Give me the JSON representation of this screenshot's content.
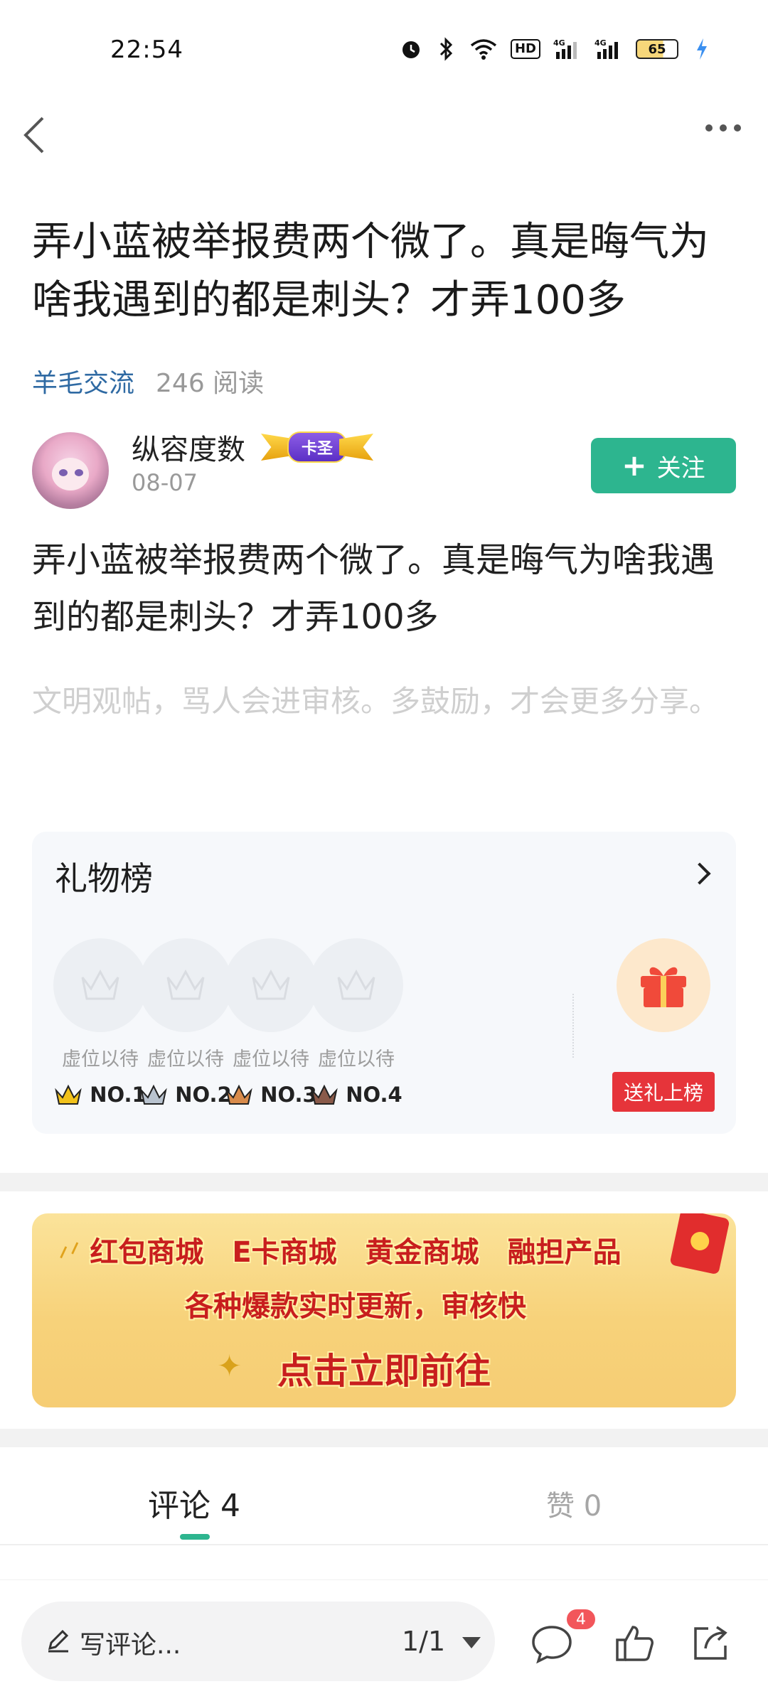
{
  "status_bar": {
    "time": "22:54",
    "icons": [
      "alarm-icon",
      "bluetooth-icon",
      "wifi-icon",
      "hd-icon",
      "signal-4g-icon",
      "signal-4g-icon",
      "battery-icon",
      "charging-icon"
    ],
    "hd_label": "HD",
    "battery_level": "65"
  },
  "nav": {
    "back_icon": "chevron-left-icon",
    "more_icon": "more-horizontal-icon"
  },
  "post": {
    "title": "弄小蓝被举报费两个微了。真是晦气为啥我遇到的都是刺头？才弄100多",
    "category": "羊毛交流",
    "reads": "246 阅读",
    "body": "弄小蓝被举报费两个微了。真是晦气为啥我遇到的都是刺头？才弄100多",
    "notice": "文明观帖，骂人会进审核。多鼓励，才会更多分享。"
  },
  "author": {
    "name": "纵容度数",
    "badge": "卡圣",
    "date": "08-07",
    "follow_label": "关注",
    "follow_icon": "plus-icon"
  },
  "gift_board": {
    "title": "礼物榜",
    "slots": [
      {
        "label": "虚位以待",
        "rank": "NO.1",
        "crown_color": "#f2c21b"
      },
      {
        "label": "虚位以待",
        "rank": "NO.2",
        "crown_color": "#b9c3cf"
      },
      {
        "label": "虚位以待",
        "rank": "NO.3",
        "crown_color": "#d98b4b"
      },
      {
        "label": "虚位以待",
        "rank": "NO.4",
        "crown_color": "#8a5a4a"
      }
    ],
    "send_gift_label": "送礼上榜"
  },
  "banner": {
    "row1": [
      "红包商城",
      "E卡商城",
      "黄金商城",
      "融担产品"
    ],
    "row2": "各种爆款实时更新，审核快",
    "row3": "点击立即前往"
  },
  "tabs": {
    "comments": "评论 4",
    "likes": "赞 0"
  },
  "bottom_bar": {
    "placeholder": "写评论...",
    "page": "1/1",
    "comment_count": "4"
  },
  "colors": {
    "accent": "#2db58f",
    "link": "#2f6aa3",
    "red": "#e6343a"
  }
}
